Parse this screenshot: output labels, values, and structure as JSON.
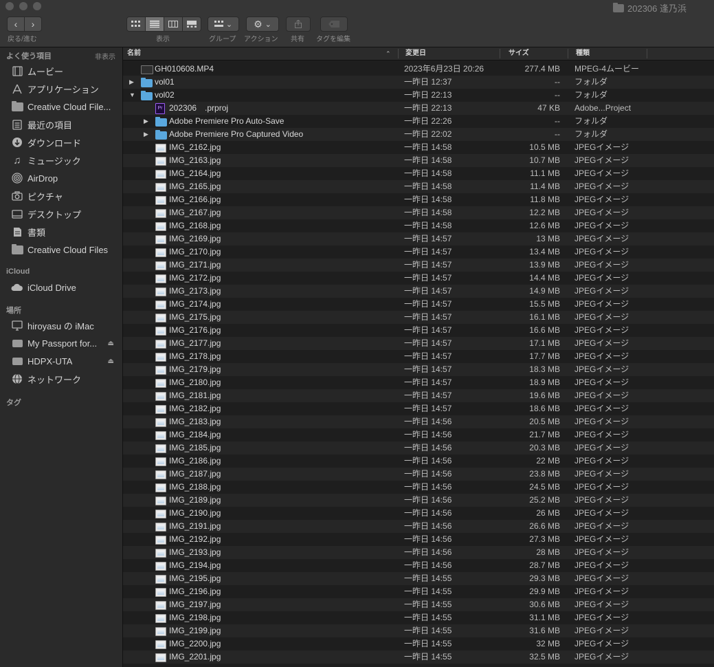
{
  "window": {
    "title": "202306 逢乃浜"
  },
  "toolbar": {
    "nav_label": "戻る/進む",
    "view_label": "表示",
    "group_label": "グループ",
    "action_label": "アクション",
    "share_label": "共有",
    "tags_label": "タグを編集"
  },
  "sidebar": {
    "favorites_header": "よく使う項目",
    "hide_label": "非表示",
    "favorites": [
      {
        "label": "ムービー",
        "icon": "film-icon"
      },
      {
        "label": "アプリケーション",
        "icon": "apps-icon"
      },
      {
        "label": "Creative Cloud File...",
        "icon": "folder-icon"
      },
      {
        "label": "最近の項目",
        "icon": "recents-icon"
      },
      {
        "label": "ダウンロード",
        "icon": "download-icon"
      },
      {
        "label": "ミュージック",
        "icon": "music-icon"
      },
      {
        "label": "AirDrop",
        "icon": "airdrop-icon"
      },
      {
        "label": "ピクチャ",
        "icon": "camera-icon"
      },
      {
        "label": "デスクトップ",
        "icon": "desktop-icon"
      },
      {
        "label": "書類",
        "icon": "document-icon"
      },
      {
        "label": "Creative Cloud Files",
        "icon": "folder-icon"
      }
    ],
    "icloud_header": "iCloud",
    "icloud": [
      {
        "label": "iCloud Drive",
        "icon": "cloud-icon"
      }
    ],
    "locations_header": "場所",
    "locations": [
      {
        "label": "hiroyasu の iMac",
        "icon": "imac-icon"
      },
      {
        "label": "My Passport for...",
        "icon": "disk-icon"
      },
      {
        "label": "HDPX-UTA",
        "icon": "disk-icon"
      },
      {
        "label": "ネットワーク",
        "icon": "network-icon"
      }
    ],
    "tags_header": "タグ"
  },
  "columns": {
    "name": "名前",
    "modified": "変更日",
    "size": "サイズ",
    "kind": "種類"
  },
  "files": [
    {
      "name": "GH010608.MP4",
      "date": "2023年6月23日 20:26",
      "size": "277.4 MB",
      "kind": "MPEG-4ムービー",
      "type": "video",
      "level": 0,
      "disclosure": "none"
    },
    {
      "name": "vol01",
      "date": "一昨日 12:37",
      "size": "--",
      "kind": "フォルダ",
      "type": "folder",
      "level": 0,
      "disclosure": "collapsed"
    },
    {
      "name": "vol02",
      "date": "一昨日 22:13",
      "size": "--",
      "kind": "フォルダ",
      "type": "folder",
      "level": 0,
      "disclosure": "expanded"
    },
    {
      "name": "202306　.prproj",
      "date": "一昨日 22:13",
      "size": "47 KB",
      "kind": "Adobe...Project",
      "type": "prproj",
      "level": 1,
      "disclosure": "none"
    },
    {
      "name": "Adobe Premiere Pro Auto-Save",
      "date": "一昨日 22:26",
      "size": "--",
      "kind": "フォルダ",
      "type": "folder",
      "level": 1,
      "disclosure": "collapsed"
    },
    {
      "name": "Adobe Premiere Pro Captured Video",
      "date": "一昨日 22:02",
      "size": "--",
      "kind": "フォルダ",
      "type": "folder",
      "level": 1,
      "disclosure": "collapsed"
    },
    {
      "name": "IMG_2162.jpg",
      "date": "一昨日 14:58",
      "size": "10.5 MB",
      "kind": "JPEGイメージ",
      "type": "jpg",
      "level": 1,
      "disclosure": "none"
    },
    {
      "name": "IMG_2163.jpg",
      "date": "一昨日 14:58",
      "size": "10.7 MB",
      "kind": "JPEGイメージ",
      "type": "jpg",
      "level": 1,
      "disclosure": "none"
    },
    {
      "name": "IMG_2164.jpg",
      "date": "一昨日 14:58",
      "size": "11.1 MB",
      "kind": "JPEGイメージ",
      "type": "jpg",
      "level": 1,
      "disclosure": "none"
    },
    {
      "name": "IMG_2165.jpg",
      "date": "一昨日 14:58",
      "size": "11.4 MB",
      "kind": "JPEGイメージ",
      "type": "jpg",
      "level": 1,
      "disclosure": "none"
    },
    {
      "name": "IMG_2166.jpg",
      "date": "一昨日 14:58",
      "size": "11.8 MB",
      "kind": "JPEGイメージ",
      "type": "jpg",
      "level": 1,
      "disclosure": "none"
    },
    {
      "name": "IMG_2167.jpg",
      "date": "一昨日 14:58",
      "size": "12.2 MB",
      "kind": "JPEGイメージ",
      "type": "jpg",
      "level": 1,
      "disclosure": "none"
    },
    {
      "name": "IMG_2168.jpg",
      "date": "一昨日 14:58",
      "size": "12.6 MB",
      "kind": "JPEGイメージ",
      "type": "jpg",
      "level": 1,
      "disclosure": "none"
    },
    {
      "name": "IMG_2169.jpg",
      "date": "一昨日 14:57",
      "size": "13 MB",
      "kind": "JPEGイメージ",
      "type": "jpg",
      "level": 1,
      "disclosure": "none"
    },
    {
      "name": "IMG_2170.jpg",
      "date": "一昨日 14:57",
      "size": "13.4 MB",
      "kind": "JPEGイメージ",
      "type": "jpg",
      "level": 1,
      "disclosure": "none"
    },
    {
      "name": "IMG_2171.jpg",
      "date": "一昨日 14:57",
      "size": "13.9 MB",
      "kind": "JPEGイメージ",
      "type": "jpg",
      "level": 1,
      "disclosure": "none"
    },
    {
      "name": "IMG_2172.jpg",
      "date": "一昨日 14:57",
      "size": "14.4 MB",
      "kind": "JPEGイメージ",
      "type": "jpg",
      "level": 1,
      "disclosure": "none"
    },
    {
      "name": "IMG_2173.jpg",
      "date": "一昨日 14:57",
      "size": "14.9 MB",
      "kind": "JPEGイメージ",
      "type": "jpg",
      "level": 1,
      "disclosure": "none"
    },
    {
      "name": "IMG_2174.jpg",
      "date": "一昨日 14:57",
      "size": "15.5 MB",
      "kind": "JPEGイメージ",
      "type": "jpg",
      "level": 1,
      "disclosure": "none"
    },
    {
      "name": "IMG_2175.jpg",
      "date": "一昨日 14:57",
      "size": "16.1 MB",
      "kind": "JPEGイメージ",
      "type": "jpg",
      "level": 1,
      "disclosure": "none"
    },
    {
      "name": "IMG_2176.jpg",
      "date": "一昨日 14:57",
      "size": "16.6 MB",
      "kind": "JPEGイメージ",
      "type": "jpg",
      "level": 1,
      "disclosure": "none"
    },
    {
      "name": "IMG_2177.jpg",
      "date": "一昨日 14:57",
      "size": "17.1 MB",
      "kind": "JPEGイメージ",
      "type": "jpg",
      "level": 1,
      "disclosure": "none"
    },
    {
      "name": "IMG_2178.jpg",
      "date": "一昨日 14:57",
      "size": "17.7 MB",
      "kind": "JPEGイメージ",
      "type": "jpg",
      "level": 1,
      "disclosure": "none"
    },
    {
      "name": "IMG_2179.jpg",
      "date": "一昨日 14:57",
      "size": "18.3 MB",
      "kind": "JPEGイメージ",
      "type": "jpg",
      "level": 1,
      "disclosure": "none"
    },
    {
      "name": "IMG_2180.jpg",
      "date": "一昨日 14:57",
      "size": "18.9 MB",
      "kind": "JPEGイメージ",
      "type": "jpg",
      "level": 1,
      "disclosure": "none"
    },
    {
      "name": "IMG_2181.jpg",
      "date": "一昨日 14:57",
      "size": "19.6 MB",
      "kind": "JPEGイメージ",
      "type": "jpg",
      "level": 1,
      "disclosure": "none"
    },
    {
      "name": "IMG_2182.jpg",
      "date": "一昨日 14:57",
      "size": "18.6 MB",
      "kind": "JPEGイメージ",
      "type": "jpg",
      "level": 1,
      "disclosure": "none"
    },
    {
      "name": "IMG_2183.jpg",
      "date": "一昨日 14:56",
      "size": "20.5 MB",
      "kind": "JPEGイメージ",
      "type": "jpg",
      "level": 1,
      "disclosure": "none"
    },
    {
      "name": "IMG_2184.jpg",
      "date": "一昨日 14:56",
      "size": "21.7 MB",
      "kind": "JPEGイメージ",
      "type": "jpg",
      "level": 1,
      "disclosure": "none"
    },
    {
      "name": "IMG_2185.jpg",
      "date": "一昨日 14:56",
      "size": "20.3 MB",
      "kind": "JPEGイメージ",
      "type": "jpg",
      "level": 1,
      "disclosure": "none"
    },
    {
      "name": "IMG_2186.jpg",
      "date": "一昨日 14:56",
      "size": "22 MB",
      "kind": "JPEGイメージ",
      "type": "jpg",
      "level": 1,
      "disclosure": "none"
    },
    {
      "name": "IMG_2187.jpg",
      "date": "一昨日 14:56",
      "size": "23.8 MB",
      "kind": "JPEGイメージ",
      "type": "jpg",
      "level": 1,
      "disclosure": "none"
    },
    {
      "name": "IMG_2188.jpg",
      "date": "一昨日 14:56",
      "size": "24.5 MB",
      "kind": "JPEGイメージ",
      "type": "jpg",
      "level": 1,
      "disclosure": "none"
    },
    {
      "name": "IMG_2189.jpg",
      "date": "一昨日 14:56",
      "size": "25.2 MB",
      "kind": "JPEGイメージ",
      "type": "jpg",
      "level": 1,
      "disclosure": "none"
    },
    {
      "name": "IMG_2190.jpg",
      "date": "一昨日 14:56",
      "size": "26 MB",
      "kind": "JPEGイメージ",
      "type": "jpg",
      "level": 1,
      "disclosure": "none"
    },
    {
      "name": "IMG_2191.jpg",
      "date": "一昨日 14:56",
      "size": "26.6 MB",
      "kind": "JPEGイメージ",
      "type": "jpg",
      "level": 1,
      "disclosure": "none"
    },
    {
      "name": "IMG_2192.jpg",
      "date": "一昨日 14:56",
      "size": "27.3 MB",
      "kind": "JPEGイメージ",
      "type": "jpg",
      "level": 1,
      "disclosure": "none"
    },
    {
      "name": "IMG_2193.jpg",
      "date": "一昨日 14:56",
      "size": "28 MB",
      "kind": "JPEGイメージ",
      "type": "jpg",
      "level": 1,
      "disclosure": "none"
    },
    {
      "name": "IMG_2194.jpg",
      "date": "一昨日 14:56",
      "size": "28.7 MB",
      "kind": "JPEGイメージ",
      "type": "jpg",
      "level": 1,
      "disclosure": "none"
    },
    {
      "name": "IMG_2195.jpg",
      "date": "一昨日 14:55",
      "size": "29.3 MB",
      "kind": "JPEGイメージ",
      "type": "jpg",
      "level": 1,
      "disclosure": "none"
    },
    {
      "name": "IMG_2196.jpg",
      "date": "一昨日 14:55",
      "size": "29.9 MB",
      "kind": "JPEGイメージ",
      "type": "jpg",
      "level": 1,
      "disclosure": "none"
    },
    {
      "name": "IMG_2197.jpg",
      "date": "一昨日 14:55",
      "size": "30.6 MB",
      "kind": "JPEGイメージ",
      "type": "jpg",
      "level": 1,
      "disclosure": "none"
    },
    {
      "name": "IMG_2198.jpg",
      "date": "一昨日 14:55",
      "size": "31.1 MB",
      "kind": "JPEGイメージ",
      "type": "jpg",
      "level": 1,
      "disclosure": "none"
    },
    {
      "name": "IMG_2199.jpg",
      "date": "一昨日 14:55",
      "size": "31.6 MB",
      "kind": "JPEGイメージ",
      "type": "jpg",
      "level": 1,
      "disclosure": "none"
    },
    {
      "name": "IMG_2200.jpg",
      "date": "一昨日 14:55",
      "size": "32 MB",
      "kind": "JPEGイメージ",
      "type": "jpg",
      "level": 1,
      "disclosure": "none"
    },
    {
      "name": "IMG_2201.jpg",
      "date": "一昨日 14:55",
      "size": "32.5 MB",
      "kind": "JPEGイメージ",
      "type": "jpg",
      "level": 1,
      "disclosure": "none"
    }
  ]
}
